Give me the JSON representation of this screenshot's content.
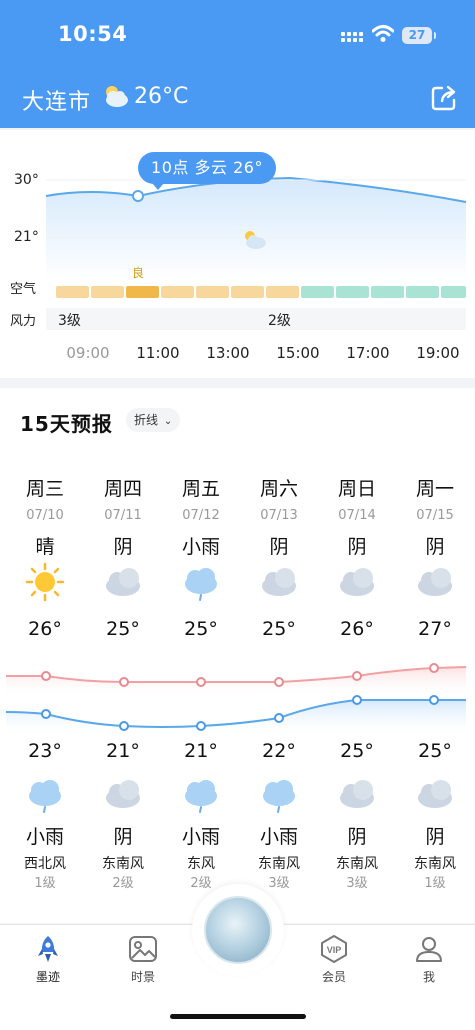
{
  "status_bar": {
    "time": "10:54",
    "battery": "27"
  },
  "header": {
    "city": "大连市",
    "temp": "26°C",
    "icon": "partly-cloudy-icon"
  },
  "hourly": {
    "y_labels": [
      "30°",
      "21°"
    ],
    "tooltip": "10点 多云 26°",
    "air_label": "空气",
    "air_quality_label": "良",
    "wind_label": "风力",
    "wind_values": [
      "3级",
      "2级"
    ],
    "times": [
      "09:00",
      "11:00",
      "13:00",
      "15:00",
      "17:00",
      "19:00"
    ]
  },
  "forecast": {
    "title": "15天预报",
    "toggle": "折线",
    "days": [
      {
        "name": "周三",
        "date": "07/10",
        "day_weather": "晴",
        "day_icon": "sunny-icon",
        "high": "26°",
        "low": "23°",
        "night_icon": "rain-icon",
        "night_weather": "小雨",
        "wind_dir": "西北风",
        "wind_level": "1级"
      },
      {
        "name": "周四",
        "date": "07/11",
        "day_weather": "阴",
        "day_icon": "cloudy-icon",
        "high": "25°",
        "low": "21°",
        "night_icon": "cloudy-icon",
        "night_weather": "阴",
        "wind_dir": "东南风",
        "wind_level": "2级"
      },
      {
        "name": "周五",
        "date": "07/12",
        "day_weather": "小雨",
        "day_icon": "rain-icon",
        "high": "25°",
        "low": "21°",
        "night_icon": "rain-icon",
        "night_weather": "小雨",
        "wind_dir": "东风",
        "wind_level": "2级"
      },
      {
        "name": "周六",
        "date": "07/13",
        "day_weather": "阴",
        "day_icon": "cloudy-icon",
        "high": "25°",
        "low": "22°",
        "night_icon": "rain-icon",
        "night_weather": "小雨",
        "wind_dir": "东南风",
        "wind_level": "3级"
      },
      {
        "name": "周日",
        "date": "07/14",
        "day_weather": "阴",
        "day_icon": "cloudy-icon",
        "high": "26°",
        "low": "25°",
        "night_icon": "cloudy-icon",
        "night_weather": "阴",
        "wind_dir": "东南风",
        "wind_level": "3级"
      },
      {
        "name": "周一",
        "date": "07/15",
        "day_weather": "阴",
        "day_icon": "cloudy-icon",
        "high": "27°",
        "low": "25°",
        "night_icon": "cloudy-icon",
        "night_weather": "阴",
        "wind_dir": "东南风",
        "wind_level": "1级"
      }
    ]
  },
  "nav": {
    "items": [
      {
        "label": "墨迹",
        "icon": "rocket-icon",
        "active": true
      },
      {
        "label": "时景",
        "icon": "image-icon",
        "active": false
      },
      {
        "label": "会员",
        "icon": "vip-icon",
        "active": false
      },
      {
        "label": "我",
        "icon": "profile-icon",
        "active": false
      }
    ]
  },
  "colors": {
    "accent": "#4a9af3",
    "high_line": "#f2a0a4",
    "low_line": "#5aa7ea",
    "air_good": "#f5c97a",
    "air_excellent": "#8fd8c3"
  }
}
